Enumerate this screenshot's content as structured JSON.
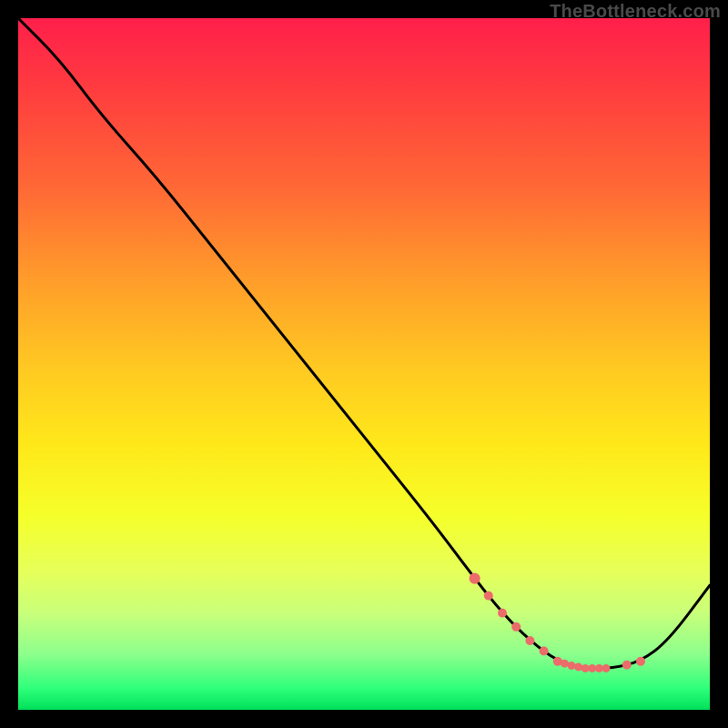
{
  "watermark": "TheBottleneck.com",
  "colors": {
    "page_bg": "#000000",
    "line": "#000000",
    "marker": "#ec6b6b"
  },
  "chart_data": {
    "type": "line",
    "title": "",
    "xlabel": "",
    "ylabel": "",
    "xlim": [
      0,
      100
    ],
    "ylim": [
      0,
      100
    ],
    "grid": false,
    "legend": false,
    "series": [
      {
        "name": "curve",
        "x": [
          0,
          6,
          12,
          20,
          28,
          36,
          44,
          52,
          60,
          66,
          70,
          74,
          78,
          82,
          86,
          90,
          94,
          100
        ],
        "y": [
          100,
          94,
          86,
          77,
          67,
          57,
          47,
          37,
          27,
          19,
          14,
          10,
          7,
          6,
          6,
          7,
          10,
          18
        ]
      }
    ],
    "markers": {
      "x": [
        66,
        68,
        70,
        72,
        74,
        76,
        78,
        79,
        80,
        81,
        82,
        83,
        84,
        85,
        88,
        90
      ],
      "y": [
        19,
        16.5,
        14,
        12,
        10,
        8.5,
        7,
        6.7,
        6.4,
        6.2,
        6,
        6,
        6,
        6,
        6.5,
        7
      ],
      "r": [
        6,
        5,
        5,
        5,
        5,
        5,
        5,
        4.5,
        4.5,
        4.5,
        4.5,
        4.5,
        4.5,
        4.5,
        5,
        5
      ]
    }
  }
}
